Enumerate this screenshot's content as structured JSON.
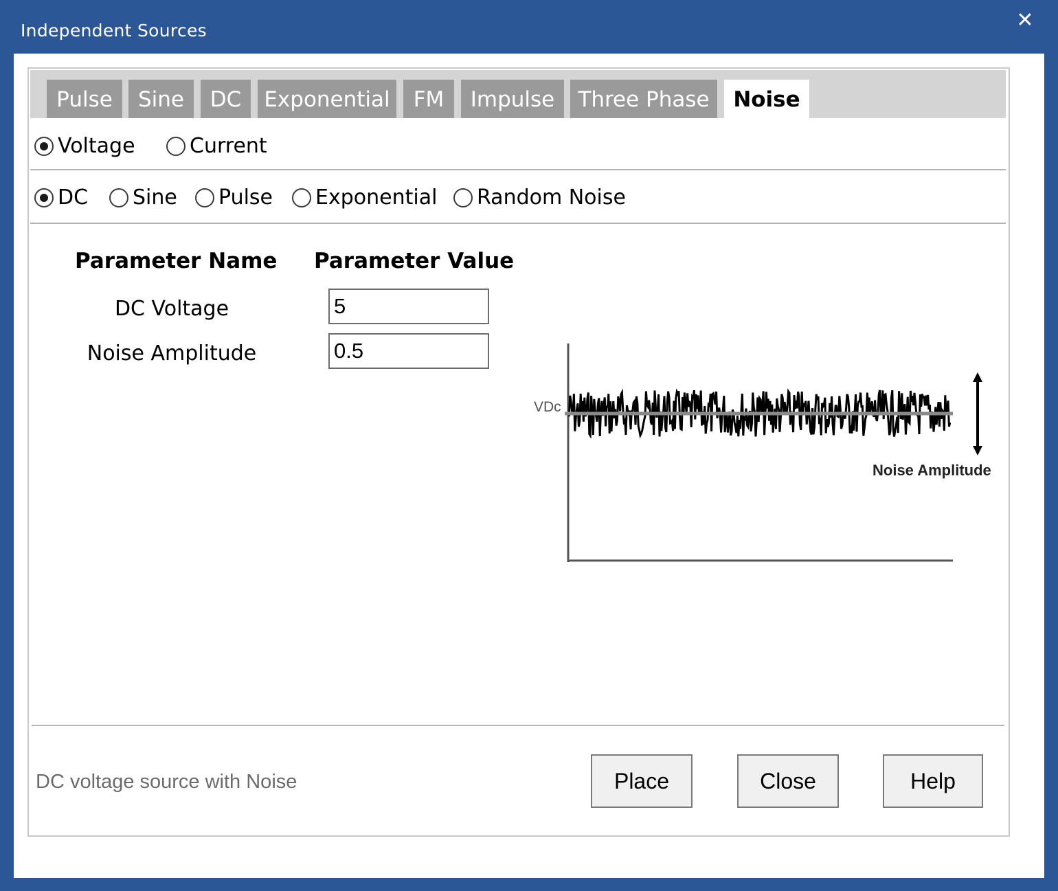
{
  "window": {
    "title": "Independent Sources",
    "close_glyph": "✕",
    "close_icon": "close-icon"
  },
  "tabs": [
    {
      "label": "Pulse",
      "active": false
    },
    {
      "label": "Sine",
      "active": false
    },
    {
      "label": "DC",
      "active": false
    },
    {
      "label": "Exponential",
      "active": false
    },
    {
      "label": "FM",
      "active": false
    },
    {
      "label": "Impulse",
      "active": false
    },
    {
      "label": "Three Phase",
      "active": false
    },
    {
      "label": "Noise",
      "active": true
    }
  ],
  "source_kind": {
    "options": [
      {
        "label": "Voltage",
        "selected": true
      },
      {
        "label": "Current",
        "selected": false
      }
    ]
  },
  "waveform": {
    "options": [
      {
        "label": "DC",
        "selected": true
      },
      {
        "label": "Sine",
        "selected": false
      },
      {
        "label": "Pulse",
        "selected": false
      },
      {
        "label": "Exponential",
        "selected": false
      },
      {
        "label": "Random Noise",
        "selected": false
      }
    ]
  },
  "params": {
    "header_name": "Parameter Name",
    "header_value": "Parameter Value",
    "rows": [
      {
        "name": "DC Voltage",
        "value": "5"
      },
      {
        "name": "Noise Amplitude",
        "value": "0.5"
      }
    ]
  },
  "diagram": {
    "level_label": "VDc",
    "amplitude_label": "Noise Amplitude"
  },
  "status": {
    "text": "DC voltage source with Noise"
  },
  "buttons": {
    "place": "Place",
    "close": "Close",
    "help": "Help"
  }
}
